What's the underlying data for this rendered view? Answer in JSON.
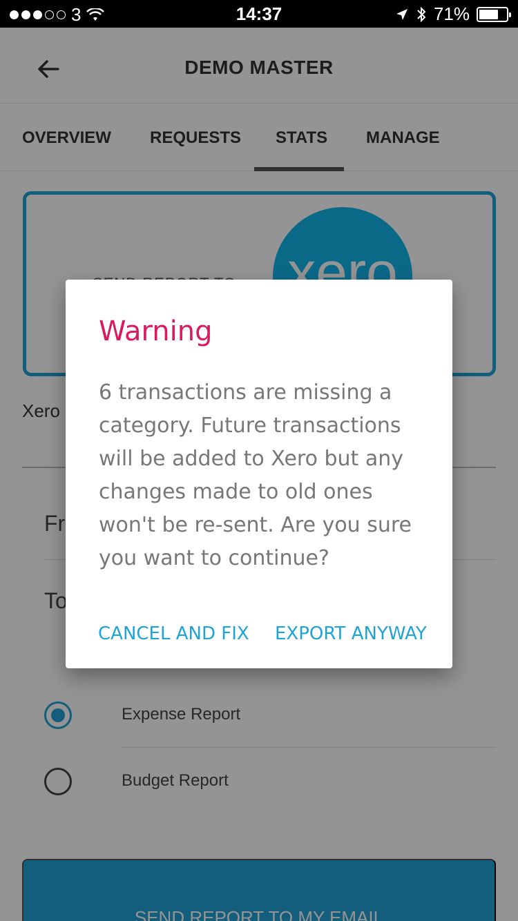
{
  "status_bar": {
    "carrier": "3",
    "time": "14:37",
    "battery_percent": "71%",
    "battery_level": 0.71
  },
  "header": {
    "title": "DEMO MASTER",
    "back_icon": "arrow-left-icon"
  },
  "tabs": [
    {
      "label": "OVERVIEW"
    },
    {
      "label": "REQUESTS"
    },
    {
      "label": "STATS",
      "active": true
    },
    {
      "label": "MANAGE"
    }
  ],
  "xero_card": {
    "send_to_label": "SEND REPORT TO",
    "logo_text": "xero"
  },
  "xero_field_label": "Xero",
  "date_fields": {
    "from_label": "Fr",
    "to_label": "To"
  },
  "report_types": [
    {
      "label": "Expense Report",
      "selected": true
    },
    {
      "label": "Budget Report",
      "selected": false
    }
  ],
  "send_email_button": "SEND REPORT TO MY EMAIL",
  "dialog": {
    "title": "Warning",
    "message": "6 transactions are missing a category. Future transactions will be added to Xero but any changes made to old ones won't be re-sent. Are you sure you want to continue?",
    "cancel_label": "CANCEL AND FIX",
    "confirm_label": "EXPORT ANYWAY"
  },
  "colors": {
    "accent": "#1fa3d6",
    "warning_title": "#d81b60",
    "xero_brand": "#13b5ea"
  }
}
